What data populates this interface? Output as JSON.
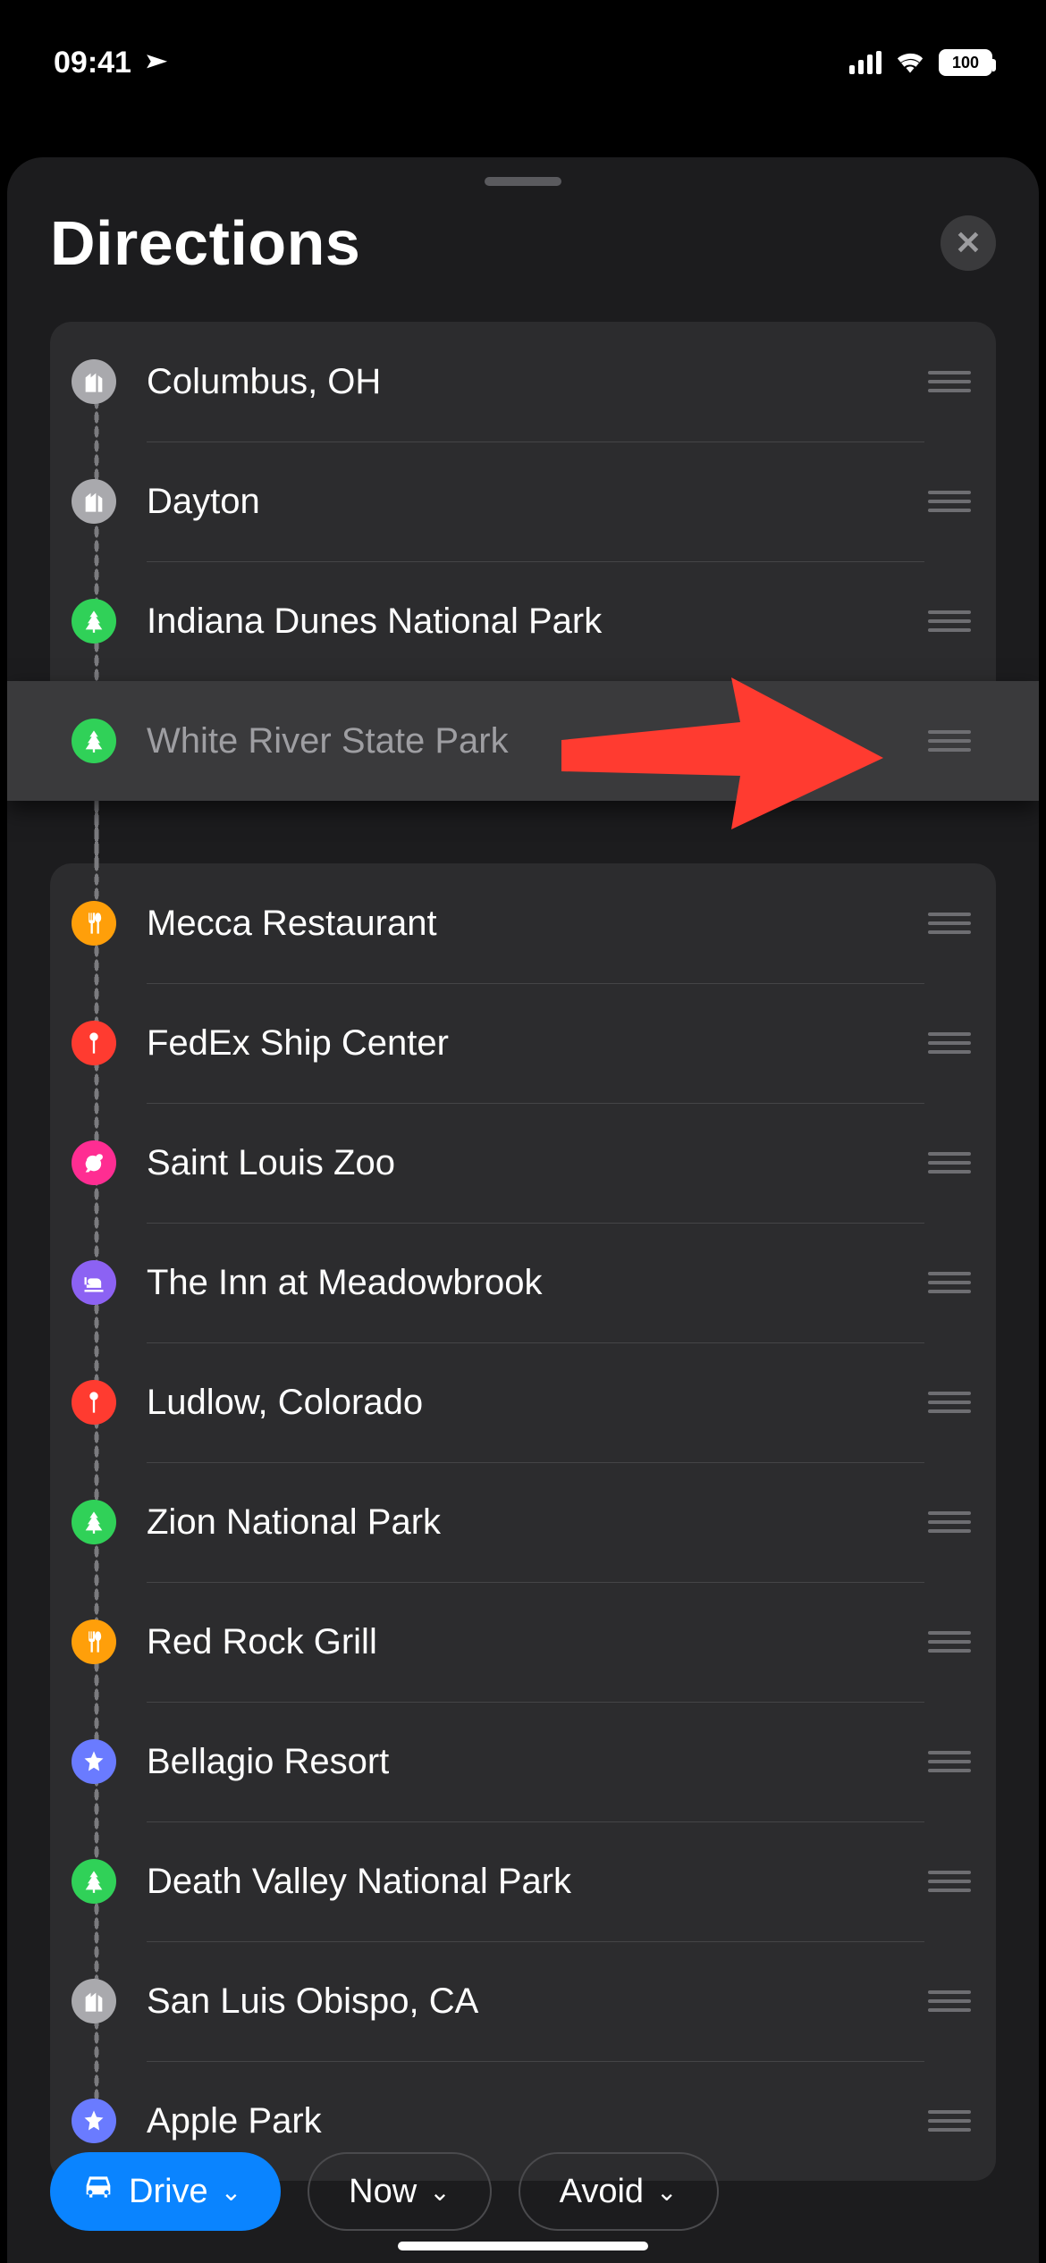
{
  "status": {
    "time": "09:41",
    "battery": "100"
  },
  "sheet": {
    "title": "Directions"
  },
  "stops_top": [
    {
      "label": "Columbus, OH",
      "icon": "city"
    },
    {
      "label": "Dayton",
      "icon": "city"
    },
    {
      "label": "Indiana Dunes National Park",
      "icon": "park"
    }
  ],
  "dragged_stop": {
    "label": "White River State Park",
    "icon": "park"
  },
  "stops_bottom": [
    {
      "label": "Mecca Restaurant",
      "icon": "food"
    },
    {
      "label": "FedEx Ship Center",
      "icon": "pin"
    },
    {
      "label": "Saint Louis Zoo",
      "icon": "zoo"
    },
    {
      "label": "The Inn at Meadowbrook",
      "icon": "hotel"
    },
    {
      "label": "Ludlow, Colorado",
      "icon": "pin"
    },
    {
      "label": "Zion National Park",
      "icon": "park"
    },
    {
      "label": "Red Rock Grill",
      "icon": "food"
    },
    {
      "label": "Bellagio Resort",
      "icon": "star"
    },
    {
      "label": "Death Valley National Park",
      "icon": "park"
    },
    {
      "label": "San Luis Obispo, CA",
      "icon": "city"
    },
    {
      "label": "Apple Park",
      "icon": "star"
    }
  ],
  "modes": {
    "drive": "Drive",
    "now": "Now",
    "avoid": "Avoid"
  },
  "icon_class": {
    "city": "ic-city",
    "park": "ic-park",
    "food": "ic-food",
    "pin": "ic-pin",
    "zoo": "ic-zoo",
    "hotel": "ic-hotel",
    "star": "ic-star"
  },
  "icon_svg": {
    "city": "<svg viewBox='0 0 24 24'><path d='M4 22V8l5-4v4l5-4v18H4zm12 0V6l4 3v13h-4zM6 12h2v2H6zm0 4h2v2H6zm4-4h2v2h-2zm0 4h2v2h-2z'/></svg>",
    "park": "<svg viewBox='0 0 24 24'><path d='M12 2l4 6h-2l4 6h-2l4 6H4l4-6H6l4-6H8l4-6zm-1 18h2v3h-2z'/></svg>",
    "food": "<svg viewBox='0 0 24 24'><path d='M7 2v8a2 2 0 0 0 2 2v10h2V12a2 2 0 0 0 2-2V2h-2v7h-1V2H9v7H8V2H7zm9 0c-1.7 0-3 2-3 5 0 2 1 3.5 2 4v11h2V11c1-.5 2-2 2-4 0-3-1.3-5-3-5z'/></svg>",
    "pin": "<svg viewBox='0 0 24 24'><path d='M12 2a4 4 0 0 1 4 4c0 1.9-1.3 3.4-3 3.9V22h-2V9.9C9.3 9.4 8 7.9 8 6a4 4 0 0 1 4-4z'/></svg>",
    "zoo": "<svg viewBox='0 0 24 24'><path d='M5 10c0-3 3-5 6-5 1 0 2 .3 3 .8C15 4 17 3 19 4c2 1 2 4 0 5l-1 .5c.6 1 1 2.2 1 3.5 0 4-3 7-7 7-1.2 0-2.3-.3-3.3-.8L7 21H4l2-3.2C4.7 16.5 4 14.8 4 13c0-1 .3-2 1-3z'/></svg>",
    "hotel": "<svg viewBox='0 0 24 24'><path d='M3 7h2v10h14v-5a4 4 0 0 0-4-4H9a3 3 0 1 0 0 6H3V7zm0 12h18v2H3z'/></svg>",
    "star": "<svg viewBox='0 0 24 24'><path d='M12 2l2.6 6.3L21 9l-5 4.5L17.2 21 12 17.8 6.8 21 8 13.5 3 9l6.4-.7L12 2z'/></svg>"
  }
}
